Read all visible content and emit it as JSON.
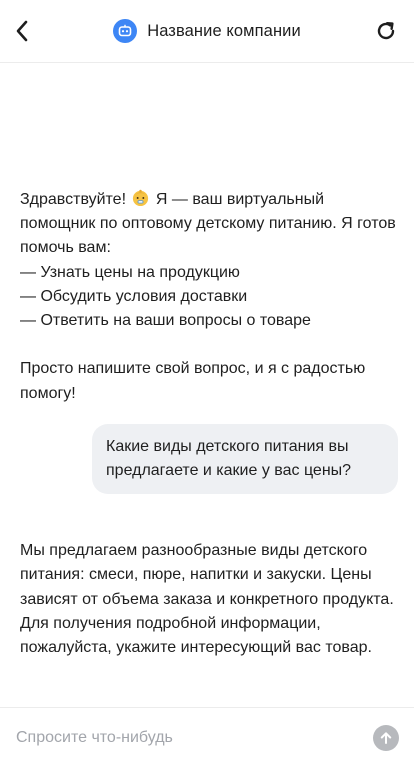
{
  "header": {
    "back_icon": "chevron-left-icon",
    "title": "Название компании",
    "avatar_icon": "bot-icon",
    "refresh_icon": "refresh-icon",
    "avatar_color": "#3d86f5"
  },
  "messages": [
    {
      "sender": "bot",
      "text_before_emoji": "Здравствуйте! ",
      "emoji": "baby-emoji",
      "text_after_emoji": " Я — ваш виртуальный помощник по оптовому детскому питанию. Я готов помочь вам:\n— Узнать цены на продукцию\n— Обсудить условия доставки\n— Ответить на ваши вопросы о товаре\n\nПросто напишите свой вопрос, и я с радостью помогу!"
    },
    {
      "sender": "user",
      "text": "Какие виды детского питания вы предлагаете и какие у вас цены?"
    },
    {
      "sender": "bot",
      "text": "Мы предлагаем разнообразные виды детского питания: смеси, пюре, напитки и закуски. Цены зависят от объема заказа и конкретного продукта. Для получения подробной информации, пожалуйста, укажите интересующий вас товар."
    }
  ],
  "composer": {
    "placeholder": "Спросите что-нибудь",
    "value": "",
    "send_icon": "arrow-up-icon",
    "send_color": "#b7b9bd"
  },
  "colors": {
    "user_bubble": "#eef0f3",
    "text": "#1f1f1f",
    "placeholder": "#a2a5ab"
  }
}
